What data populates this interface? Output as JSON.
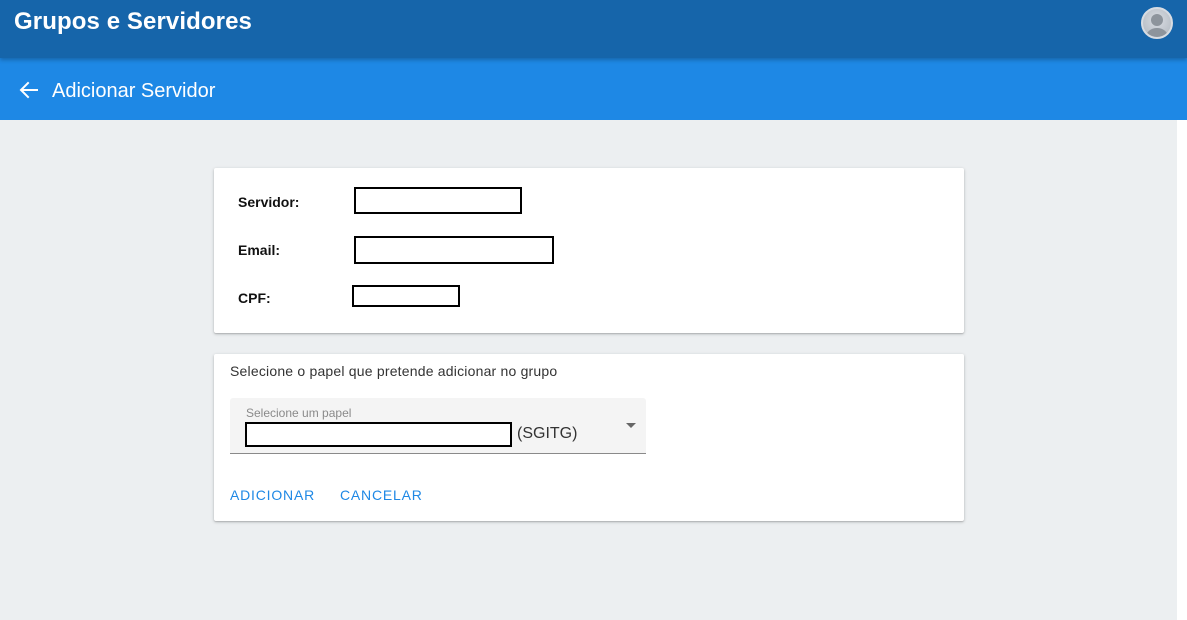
{
  "header": {
    "title": "Grupos e Servidores",
    "avatar_icon": "user-avatar-icon"
  },
  "subheader": {
    "back_icon": "arrow-left-icon",
    "title": "Adicionar Servidor"
  },
  "server_info": {
    "fields": [
      {
        "label": "Servidor:",
        "value": ""
      },
      {
        "label": "Email:",
        "value": ""
      },
      {
        "label": "CPF:",
        "value": ""
      }
    ]
  },
  "role_form": {
    "prompt": "Selecione o papel que pretende adicionar no grupo",
    "select": {
      "placeholder": "Selecione um papel",
      "value_suffix": "(SGITG)",
      "icon": "dropdown-arrow-icon"
    },
    "buttons": {
      "add_label": "ADICIONAR",
      "cancel_label": "CANCELAR"
    }
  },
  "colors": {
    "app_bar": "#1665aa",
    "sub_bar": "#1e88e5",
    "background": "#eceff1",
    "accent": "#1e88e5"
  }
}
